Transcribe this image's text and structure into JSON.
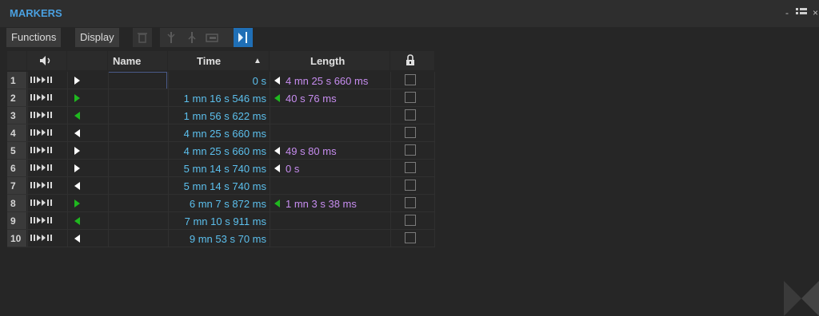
{
  "panel": {
    "title": "MARKERS",
    "window_controls": [
      "-",
      "■■",
      "×"
    ]
  },
  "toolbar": {
    "functions_label": "Functions",
    "display_label": "Display",
    "icons": [
      "trash-icon",
      "marker-range-icon",
      "marker-split-icon",
      "marker-link-icon",
      "marker-follow-icon"
    ]
  },
  "columns": {
    "play": "speaker-icon",
    "name": "Name",
    "time": "Time",
    "time_sort": "▲",
    "length": "Length",
    "lock": "lock-icon"
  },
  "colors": {
    "accent": "#4aa0e0",
    "time_text": "#5cc0ee",
    "length_text": "#c78df0",
    "marker_white": "#ffffff",
    "marker_green": "#1fb81f"
  },
  "rows": [
    {
      "num": "1",
      "marker": "start",
      "color": "white",
      "name": "",
      "time": "0 s",
      "length": "4 mn 25 s 660 ms"
    },
    {
      "num": "2",
      "marker": "start",
      "color": "green",
      "name": "",
      "time": "1 mn 16 s 546 ms",
      "length": "40 s 76 ms"
    },
    {
      "num": "3",
      "marker": "end",
      "color": "green",
      "name": "",
      "time": "1 mn 56 s 622 ms",
      "length": ""
    },
    {
      "num": "4",
      "marker": "end",
      "color": "white",
      "name": "",
      "time": "4 mn 25 s 660 ms",
      "length": ""
    },
    {
      "num": "5",
      "marker": "start",
      "color": "white",
      "name": "",
      "time": "4 mn 25 s 660 ms",
      "length": "49 s 80 ms"
    },
    {
      "num": "6",
      "marker": "start",
      "color": "white",
      "name": "",
      "time": "5 mn 14 s 740 ms",
      "length": "0 s"
    },
    {
      "num": "7",
      "marker": "end",
      "color": "white",
      "name": "",
      "time": "5 mn 14 s 740 ms",
      "length": ""
    },
    {
      "num": "8",
      "marker": "start",
      "color": "green",
      "name": "",
      "time": "6 mn 7 s 872 ms",
      "length": "1 mn 3 s 38 ms"
    },
    {
      "num": "9",
      "marker": "end",
      "color": "green",
      "name": "",
      "time": "7 mn 10 s 911 ms",
      "length": ""
    },
    {
      "num": "10",
      "marker": "end",
      "color": "white",
      "name": "",
      "time": "9 mn 53 s 70 ms",
      "length": ""
    }
  ]
}
